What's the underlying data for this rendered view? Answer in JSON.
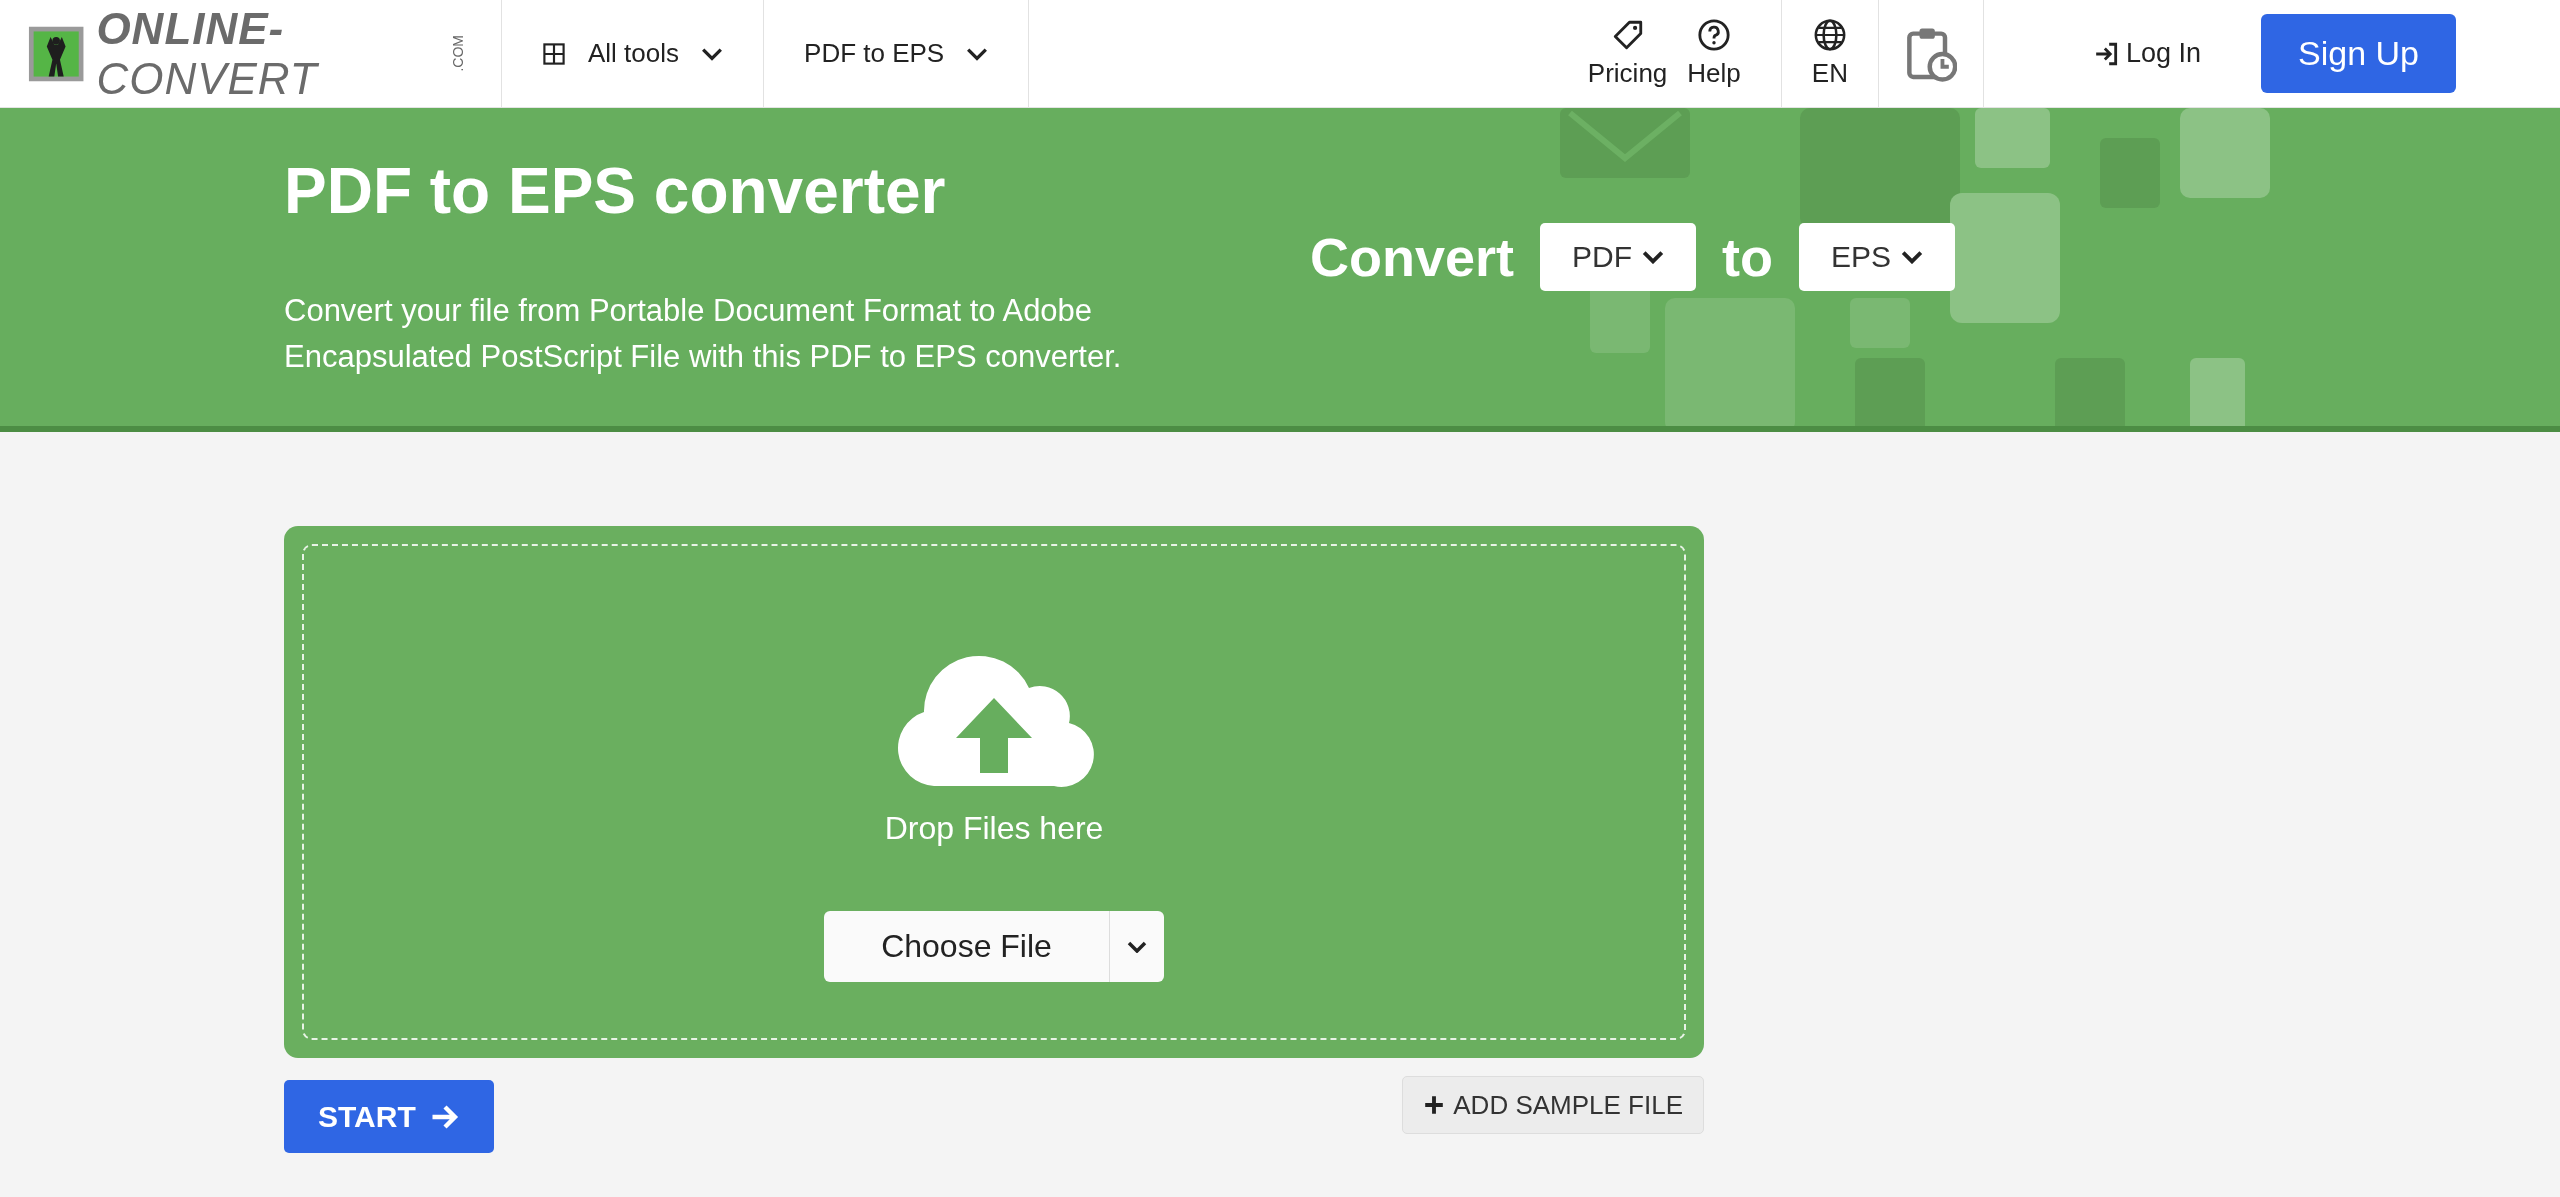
{
  "header": {
    "logo": {
      "main": "ONLINE-",
      "accent": "CONVERT",
      "suffix": ".COM"
    },
    "menus": [
      {
        "label": "All tools",
        "kind": "grid"
      },
      {
        "label": "PDF to EPS",
        "kind": "plain"
      }
    ],
    "links": [
      {
        "label": "Pricing",
        "kind": "tag"
      },
      {
        "label": "Help",
        "kind": "help"
      }
    ],
    "language": "EN",
    "login": "Log In",
    "signup": "Sign Up"
  },
  "banner": {
    "title": "PDF to EPS converter",
    "description": "Convert your file from Portable Document Format to Adobe Encapsulated PostScript File with this PDF to EPS converter.",
    "convert_label": "Convert",
    "from": "PDF",
    "to_label": "to",
    "to": "EPS"
  },
  "upload": {
    "drop_text": "Drop Files here",
    "choose_button": "Choose File",
    "start_button": "START",
    "sample_button": "ADD SAMPLE FILE"
  }
}
